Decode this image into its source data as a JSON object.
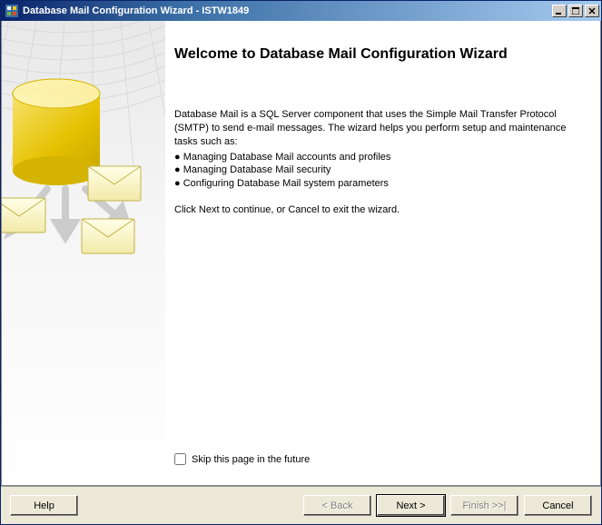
{
  "title": "Database Mail Configuration Wizard - ISTW1849",
  "heading": "Welcome to Database Mail Configuration Wizard",
  "intro": "Database Mail is a SQL Server component that uses the Simple Mail Transfer Protocol (SMTP) to send e-mail messages. The wizard helps you perform setup and maintenance tasks such as:",
  "bullets": [
    "Managing Database Mail accounts and profiles",
    "Managing Database Mail security",
    "Configuring Database Mail system parameters"
  ],
  "continueText": "Click Next to continue, or Cancel to exit the wizard.",
  "skipLabel": "Skip this page in the future",
  "buttons": {
    "help": "Help",
    "back": "< Back",
    "next": "Next >",
    "finish": "Finish >>|",
    "cancel": "Cancel"
  }
}
